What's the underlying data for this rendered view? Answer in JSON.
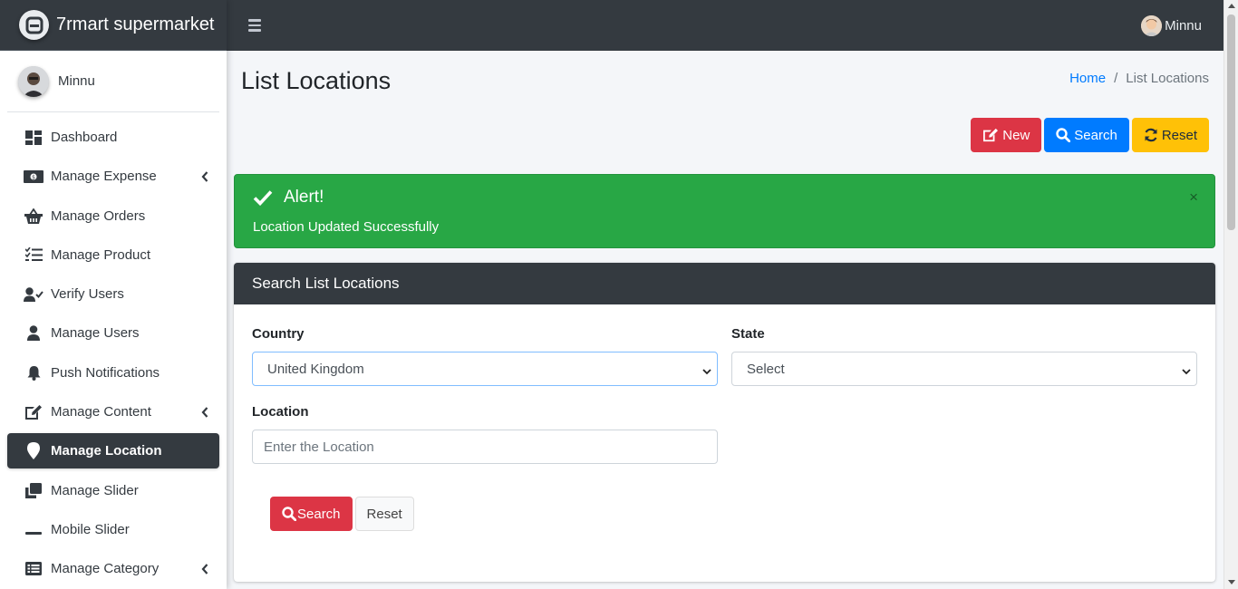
{
  "brand": {
    "name": "7rmart supermarket"
  },
  "user": {
    "name": "Minnu"
  },
  "sidebar": {
    "items": [
      {
        "label": "Dashboard",
        "icon": "dashboard-icon",
        "has_submenu": false,
        "active": false
      },
      {
        "label": "Manage Expense",
        "icon": "money-bill-icon",
        "has_submenu": true,
        "active": false
      },
      {
        "label": "Manage Orders",
        "icon": "basket-icon",
        "has_submenu": false,
        "active": false
      },
      {
        "label": "Manage Product",
        "icon": "tasks-icon",
        "has_submenu": false,
        "active": false
      },
      {
        "label": "Verify Users",
        "icon": "user-check-icon",
        "has_submenu": false,
        "active": false
      },
      {
        "label": "Manage Users",
        "icon": "user-icon",
        "has_submenu": false,
        "active": false
      },
      {
        "label": "Push Notifications",
        "icon": "bell-icon",
        "has_submenu": false,
        "active": false
      },
      {
        "label": "Manage Content",
        "icon": "edit-icon",
        "has_submenu": true,
        "active": false
      },
      {
        "label": "Manage Location",
        "icon": "map-marker-icon",
        "has_submenu": false,
        "active": true
      },
      {
        "label": "Manage Slider",
        "icon": "clone-icon",
        "has_submenu": false,
        "active": false
      },
      {
        "label": "Mobile Slider",
        "icon": "minus-icon",
        "has_submenu": false,
        "active": false
      },
      {
        "label": "Manage Category",
        "icon": "list-alt-icon",
        "has_submenu": true,
        "active": false
      }
    ]
  },
  "page": {
    "title": "List Locations",
    "breadcrumb": {
      "home": "Home",
      "separator": "/",
      "current": "List Locations"
    }
  },
  "actions": {
    "new_label": "New",
    "search_label": "Search",
    "reset_label": "Reset"
  },
  "alert": {
    "title": "Alert!",
    "message": "Location Updated Successfully",
    "close": "×"
  },
  "search_card": {
    "title": "Search List Locations",
    "country": {
      "label": "Country",
      "value": "United Kingdom"
    },
    "state": {
      "label": "State",
      "value": "Select"
    },
    "location": {
      "label": "Location",
      "placeholder": "Enter the Location",
      "value": ""
    },
    "search_label": "Search",
    "reset_label": "Reset"
  },
  "colors": {
    "topbar": "#343a40",
    "active_item": "#343a40",
    "alert_success": "#28a745",
    "btn_danger": "#dc3545",
    "btn_primary": "#007bff",
    "btn_warning": "#ffc107",
    "link": "#007bff"
  }
}
